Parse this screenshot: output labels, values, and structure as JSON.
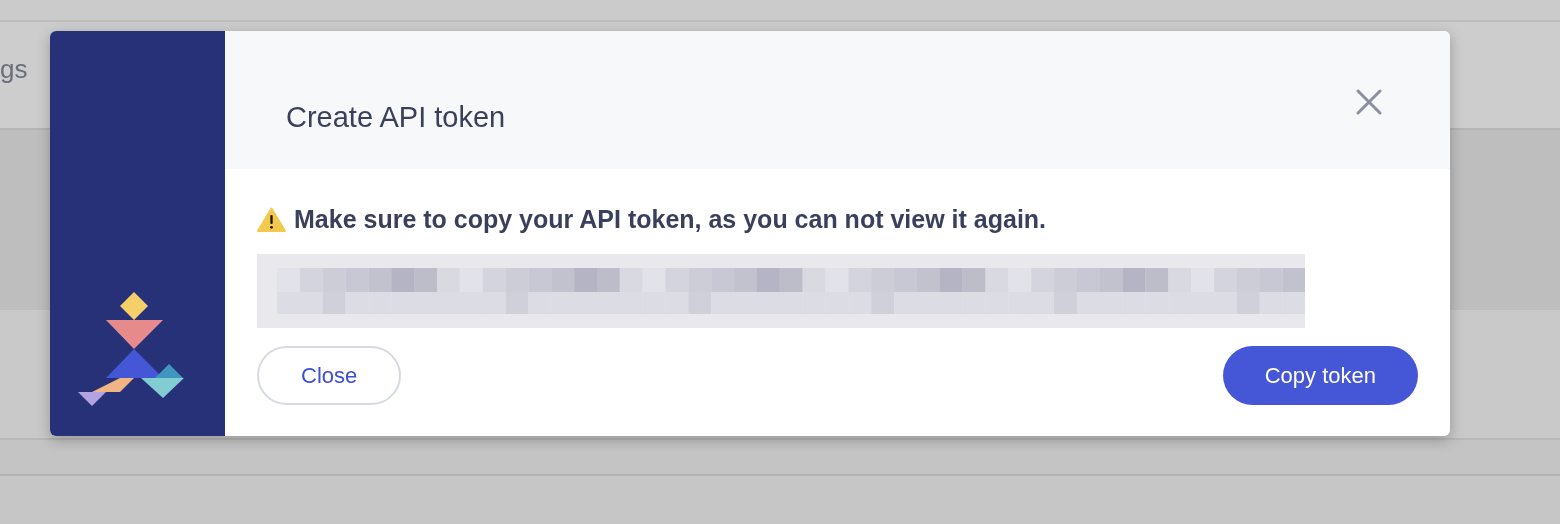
{
  "background": {
    "label_fragment": "gs"
  },
  "dialog": {
    "title": "Create API token",
    "warning": "Make sure to copy your API token, as you can not view it again.",
    "buttons": [
      {
        "label": "Close",
        "kind": "secondary"
      },
      {
        "label": "Copy token",
        "kind": "primary"
      }
    ]
  }
}
